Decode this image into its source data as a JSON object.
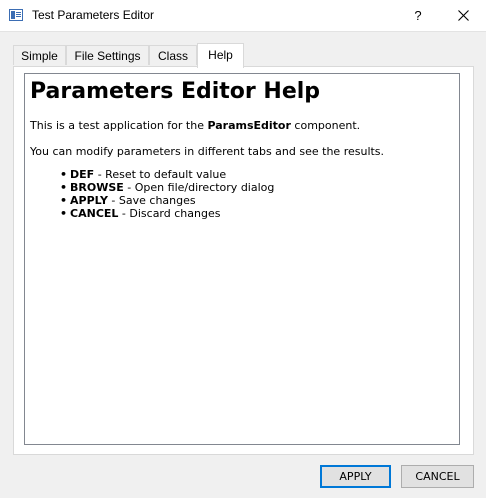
{
  "window": {
    "title": "Test Parameters Editor",
    "icon": "app-window-icon",
    "help_glyph": "?",
    "close_icon": "close-icon"
  },
  "tabs": [
    {
      "label": "Simple",
      "active": false
    },
    {
      "label": "File Settings",
      "active": false
    },
    {
      "label": "Class",
      "active": false
    },
    {
      "label": "Help",
      "active": true
    }
  ],
  "help": {
    "heading": "Parameters Editor Help",
    "intro_before": "This is a test application for the ",
    "intro_bold": "ParamsEditor",
    "intro_after": " component.",
    "modify_text": "You can modify parameters in different tabs and see the results.",
    "bullet_glyph": "•",
    "commands": [
      {
        "name": "DEF",
        "desc": " - Reset to default value"
      },
      {
        "name": "BROWSE",
        "desc": " - Open file/directory dialog"
      },
      {
        "name": "APPLY",
        "desc": " - Save changes"
      },
      {
        "name": "CANCEL",
        "desc": " - Discard changes"
      }
    ]
  },
  "buttons": {
    "apply": "APPLY",
    "cancel": "CANCEL"
  },
  "colors": {
    "accent": "#0078d7",
    "window_bg": "#f0f0f0",
    "pane_bg": "#ffffff"
  }
}
